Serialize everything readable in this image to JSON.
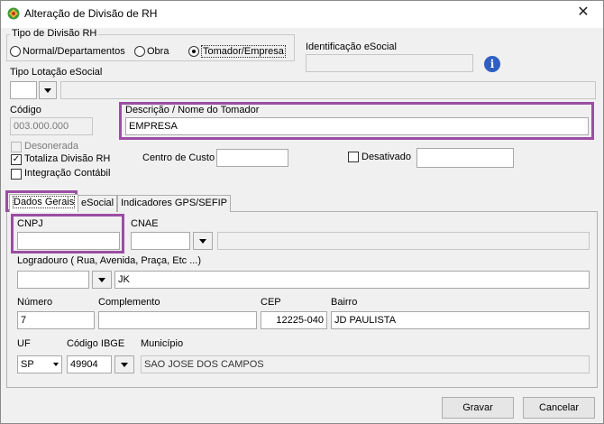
{
  "window": {
    "title": "Alteração de Divisão de RH",
    "close_glyph": "✕"
  },
  "tipo_divisao": {
    "group_label": "Tipo de Divisão RH",
    "options": [
      {
        "label": "Normal/Departamentos",
        "selected": false
      },
      {
        "label": "Obra",
        "selected": false
      },
      {
        "label": "Tomador/Empresa",
        "selected": true
      }
    ]
  },
  "identificacao": {
    "label": "Identificação eSocial",
    "value": "",
    "info_glyph": "i"
  },
  "tipo_lotacao": {
    "label": "Tipo Lotação eSocial",
    "value": "",
    "desc": ""
  },
  "codigo": {
    "label": "Código",
    "value": "003.000.000"
  },
  "descricao": {
    "label": "Descrição / Nome do Tomador",
    "value": "EMPRESA"
  },
  "flags": {
    "desonerada": {
      "label": "Desonerada",
      "checked": false
    },
    "totaliza": {
      "label": "Totaliza Divisão RH",
      "checked": true
    },
    "integracao": {
      "label": "Integração Contábil",
      "checked": false
    }
  },
  "centro_custo": {
    "label": "Centro de Custo",
    "value": ""
  },
  "desativado": {
    "label": "Desativado",
    "checked": false,
    "value": ""
  },
  "tabs": [
    {
      "label": "Dados Gerais",
      "active": true
    },
    {
      "label": "eSocial",
      "active": false
    },
    {
      "label": "Indicadores GPS/SEFIP",
      "active": false
    }
  ],
  "dados_gerais": {
    "cnpj": {
      "label": "CNPJ",
      "value": ""
    },
    "cnae": {
      "label": "CNAE",
      "value": "",
      "desc": ""
    },
    "logradouro": {
      "label": "Logradouro ( Rua, Avenida, Praça, Etc ...)",
      "tipo": "",
      "value": "JK"
    },
    "numero": {
      "label": "Número",
      "value": "7"
    },
    "complemento": {
      "label": "Complemento",
      "value": ""
    },
    "cep": {
      "label": "CEP",
      "value": "12225-040"
    },
    "bairro": {
      "label": "Bairro",
      "value": "JD PAULISTA"
    },
    "uf": {
      "label": "UF",
      "value": "SP"
    },
    "ibge": {
      "label": "Código IBGE",
      "value": "49904"
    },
    "municipio": {
      "label": "Município",
      "value": "SAO JOSE DOS CAMPOS"
    }
  },
  "buttons": {
    "gravar": "Gravar",
    "cancelar": "Cancelar"
  },
  "colors": {
    "highlight": "#9b4ea3",
    "info": "#2f5fc2"
  }
}
